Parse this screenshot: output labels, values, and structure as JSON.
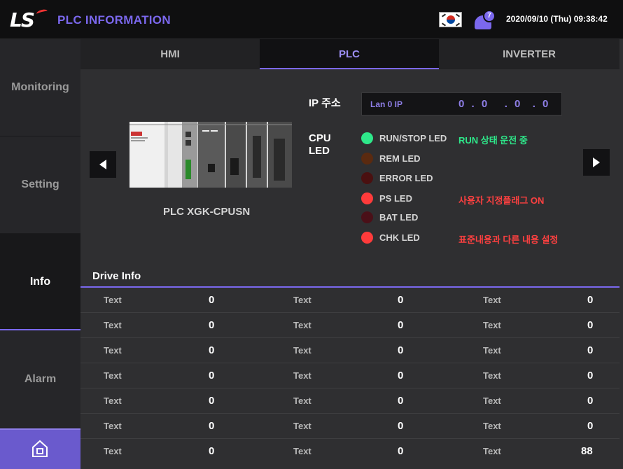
{
  "header": {
    "logo": "LS",
    "title": "PLC INFORMATION",
    "notification_count": "7",
    "datetime": "2020/09/10 (Thu) 09:38:42"
  },
  "sidebar": {
    "items": [
      {
        "label": "Monitoring",
        "active": false
      },
      {
        "label": "Setting",
        "active": false
      },
      {
        "label": "Info",
        "active": true
      },
      {
        "label": "Alarm",
        "active": false
      }
    ]
  },
  "tabs": [
    {
      "label": "HMI",
      "active": false
    },
    {
      "label": "PLC",
      "active": true
    },
    {
      "label": "INVERTER",
      "active": false
    }
  ],
  "plc": {
    "name": "PLC XGK-CPUSN",
    "ip_label": "IP 주소",
    "ip_lan": "Lan 0 IP",
    "ip_value": "0 . 0   . 0  . 0",
    "cpu_label": "CPU LED",
    "leds": [
      {
        "label": "RUN/STOP LED",
        "color": "#2ee88a",
        "note": "RUN 상태 운전 중",
        "note_color": "#2ee88a"
      },
      {
        "label": "REM LED",
        "color": "#5a2a10",
        "note": "",
        "note_color": ""
      },
      {
        "label": "ERROR LED",
        "color": "#4a1010",
        "note": "",
        "note_color": ""
      },
      {
        "label": "PS LED",
        "color": "#ff3b3b",
        "note": "사용자 지정플래그 ON",
        "note_color": "#ff4040"
      },
      {
        "label": "BAT LED",
        "color": "#4a1018",
        "note": "",
        "note_color": ""
      },
      {
        "label": "CHK LED",
        "color": "#ff3b3b",
        "note": "표준내용과 다른 내용 설정",
        "note_color": "#ff4040"
      }
    ]
  },
  "drive_info": {
    "title": "Drive Info",
    "rows": [
      [
        {
          "label": "Text",
          "value": "0"
        },
        {
          "label": "Text",
          "value": "0"
        },
        {
          "label": "Text",
          "value": "0"
        }
      ],
      [
        {
          "label": "Text",
          "value": "0"
        },
        {
          "label": "Text",
          "value": "0"
        },
        {
          "label": "Text",
          "value": "0"
        }
      ],
      [
        {
          "label": "Text",
          "value": "0"
        },
        {
          "label": "Text",
          "value": "0"
        },
        {
          "label": "Text",
          "value": "0"
        }
      ],
      [
        {
          "label": "Text",
          "value": "0"
        },
        {
          "label": "Text",
          "value": "0"
        },
        {
          "label": "Text",
          "value": "0"
        }
      ],
      [
        {
          "label": "Text",
          "value": "0"
        },
        {
          "label": "Text",
          "value": "0"
        },
        {
          "label": "Text",
          "value": "0"
        }
      ],
      [
        {
          "label": "Text",
          "value": "0"
        },
        {
          "label": "Text",
          "value": "0"
        },
        {
          "label": "Text",
          "value": "0"
        }
      ],
      [
        {
          "label": "Text",
          "value": "0"
        },
        {
          "label": "Text",
          "value": "0"
        },
        {
          "label": "Text",
          "value": "88"
        }
      ]
    ]
  },
  "icons": {
    "prev": "left-arrow-icon",
    "next": "right-arrow-icon",
    "home": "home-icon",
    "bell": "bell-icon",
    "flag": "korea-flag-icon"
  },
  "colors": {
    "accent": "#7b68ee"
  }
}
